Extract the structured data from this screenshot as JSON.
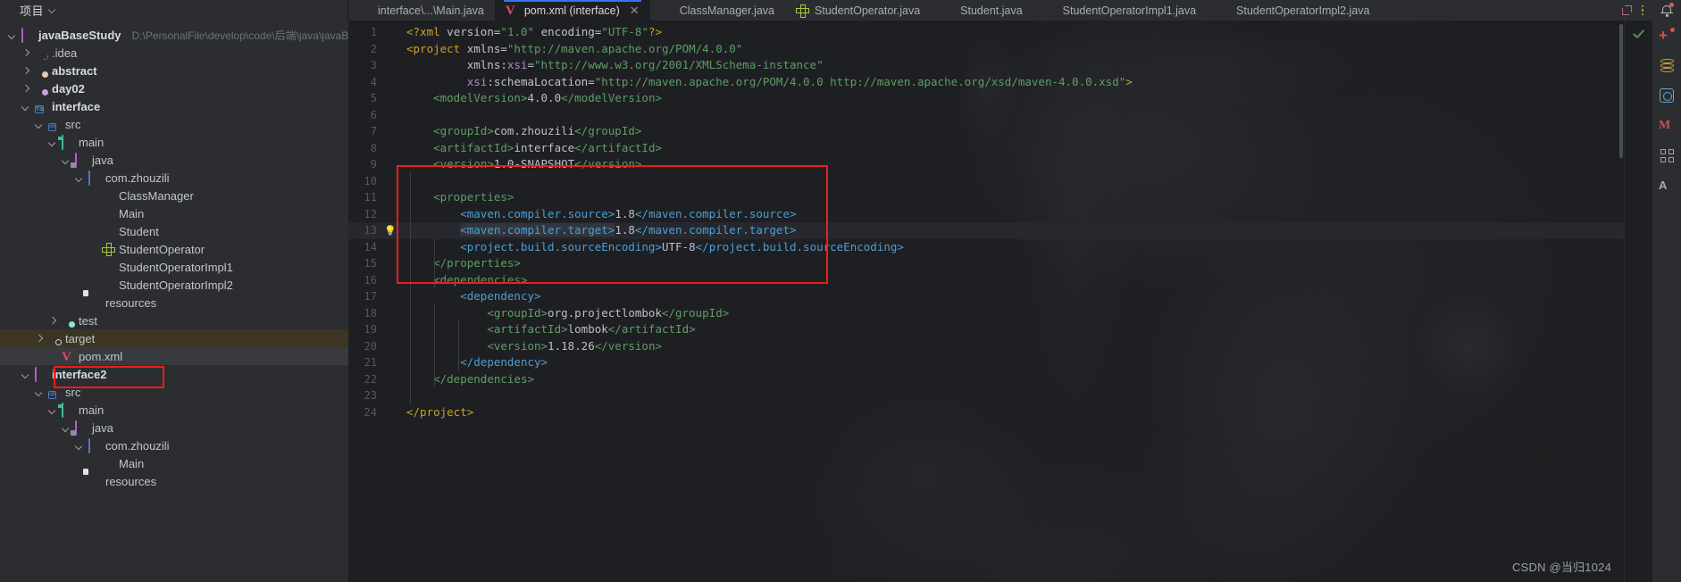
{
  "project_pane": {
    "title": "项目",
    "tree": [
      {
        "id": "javaBaseStudy",
        "label": "javaBaseStudy",
        "path": "D:\\PersonalFile\\develop\\code\\后端\\java\\javaBaseStud",
        "depth": 0,
        "arrow": "down",
        "icon": "folder-outline-purple",
        "bold": true
      },
      {
        "id": "idea",
        "label": ".idea",
        "depth": 1,
        "arrow": "right",
        "icon": "folder-idea",
        "bold": false
      },
      {
        "id": "abstract",
        "label": "abstract",
        "depth": 1,
        "arrow": "right",
        "icon": "folder-module-tan",
        "bold": true
      },
      {
        "id": "day02",
        "label": "day02",
        "depth": 1,
        "arrow": "right",
        "icon": "folder-module-purple",
        "bold": true
      },
      {
        "id": "interface",
        "label": "interface",
        "depth": 1,
        "arrow": "down",
        "icon": "folder-maven-module",
        "bold": true
      },
      {
        "id": "src",
        "label": "src",
        "depth": 2,
        "arrow": "down",
        "icon": "folder-src",
        "bold": false
      },
      {
        "id": "main",
        "label": "main",
        "depth": 3,
        "arrow": "down",
        "icon": "folder-main",
        "bold": false
      },
      {
        "id": "java",
        "label": "java",
        "depth": 4,
        "arrow": "down",
        "icon": "folder-java-source",
        "bold": false
      },
      {
        "id": "com.zhouzili",
        "label": "com.zhouzili",
        "depth": 5,
        "arrow": "down",
        "icon": "folder-package",
        "bold": false
      },
      {
        "id": "ClassManager",
        "label": "ClassManager",
        "depth": 6,
        "arrow": "none",
        "icon": "java-class",
        "bold": false
      },
      {
        "id": "Main",
        "label": "Main",
        "depth": 6,
        "arrow": "none",
        "icon": "java-class-runnable",
        "bold": false
      },
      {
        "id": "Student",
        "label": "Student",
        "depth": 6,
        "arrow": "none",
        "icon": "java-class",
        "bold": false
      },
      {
        "id": "StudentOperator",
        "label": "StudentOperator",
        "depth": 6,
        "arrow": "none",
        "icon": "java-interface",
        "bold": false
      },
      {
        "id": "StudentOperatorImpl1",
        "label": "StudentOperatorImpl1",
        "depth": 6,
        "arrow": "none",
        "icon": "java-class",
        "bold": false
      },
      {
        "id": "StudentOperatorImpl2",
        "label": "StudentOperatorImpl2",
        "depth": 6,
        "arrow": "none",
        "icon": "java-class",
        "bold": false
      },
      {
        "id": "resources",
        "label": "resources",
        "depth": 5,
        "arrow": "none",
        "icon": "folder-resources",
        "bold": false
      },
      {
        "id": "test",
        "label": "test",
        "depth": 3,
        "arrow": "right",
        "icon": "folder-test",
        "bold": false
      },
      {
        "id": "target",
        "label": "target",
        "depth": 2,
        "arrow": "right",
        "icon": "folder-target",
        "bold": false,
        "row_highlight": "amber"
      },
      {
        "id": "pom.xml",
        "label": "pom.xml",
        "depth": 3,
        "arrow": "none",
        "icon": "maven-pom",
        "bold": false,
        "row_highlight": "grey",
        "annotated": true
      },
      {
        "id": "interface2",
        "label": "interface2",
        "depth": 1,
        "arrow": "down",
        "icon": "folder-outline-purple",
        "bold": true
      },
      {
        "id": "src2",
        "label": "src",
        "depth": 2,
        "arrow": "down",
        "icon": "folder-src",
        "bold": false
      },
      {
        "id": "main2",
        "label": "main",
        "depth": 3,
        "arrow": "down",
        "icon": "folder-main",
        "bold": false
      },
      {
        "id": "java2",
        "label": "java",
        "depth": 4,
        "arrow": "down",
        "icon": "folder-java-source",
        "bold": false
      },
      {
        "id": "com.zhouzili2",
        "label": "com.zhouzili",
        "depth": 5,
        "arrow": "down",
        "icon": "folder-package",
        "bold": false
      },
      {
        "id": "Main2",
        "label": "Main",
        "depth": 6,
        "arrow": "none",
        "icon": "java-class-runnable",
        "bold": false
      },
      {
        "id": "resources2",
        "label": "resources",
        "depth": 5,
        "arrow": "none",
        "icon": "folder-resources",
        "bold": false
      }
    ]
  },
  "editor_tabs": [
    {
      "label": "interface\\...\\Main.java",
      "icon": "java-class",
      "active": false,
      "closable": false
    },
    {
      "label": "pom.xml (interface)",
      "icon": "maven-pom",
      "active": true,
      "closable": true,
      "close_glyph": "✕"
    },
    {
      "label": "ClassManager.java",
      "icon": "java-class",
      "active": false,
      "closable": false
    },
    {
      "label": "StudentOperator.java",
      "icon": "java-interface",
      "active": false,
      "closable": false
    },
    {
      "label": "Student.java",
      "icon": "java-class",
      "active": false,
      "closable": false
    },
    {
      "label": "StudentOperatorImpl1.java",
      "icon": "java-class",
      "active": false,
      "closable": false
    },
    {
      "label": "StudentOperatorImpl2.java",
      "icon": "java-class",
      "active": false,
      "closable": false
    }
  ],
  "tab_tools": {
    "expand": "expand-icon",
    "more": "more-options-icon"
  },
  "notification": {
    "icon": "bell-icon",
    "has_badge": true
  },
  "code": {
    "language": "xml",
    "lines": [
      {
        "n": 1,
        "indent": 0,
        "html": "<span class='ty'>&lt;?xml</span> <span class='at'>version=</span><span class='av'>\"1.0\"</span> <span class='at'>encoding=</span><span class='av'>\"UTF-8\"</span><span class='ty'>?&gt;</span>"
      },
      {
        "n": 2,
        "indent": 0,
        "html": "<span class='ty'>&lt;project</span> <span class='at'>xmlns=</span><span class='av'>\"http://maven.apache.org/POM/4.0.0\"</span>"
      },
      {
        "n": 3,
        "indent": 0,
        "html": "         <span class='at'>xmlns:</span><span class='vm'>xsi</span><span class='at'>=</span><span class='av'>\"http://www.w3.org/2001/XMLSchema-instance\"</span>"
      },
      {
        "n": 4,
        "indent": 0,
        "html": "         <span class='vm'>xsi</span><span class='at'>:schemaLocation=</span><span class='av'>\"http://maven.apache.org/POM/4.0.0 http://maven.apache.org/xsd/maven-4.0.0.xsd\"</span><span class='ty'>&gt;</span>"
      },
      {
        "n": 5,
        "indent": 0,
        "html": "    <span class='tg'>&lt;modelVersion&gt;</span><span class='tx'>4.0.0</span><span class='tg'>&lt;/modelVersion&gt;</span>"
      },
      {
        "n": 6,
        "indent": 0,
        "html": ""
      },
      {
        "n": 7,
        "indent": 0,
        "html": "    <span class='tg'>&lt;groupId&gt;</span><span class='tx'>com.zhouzili</span><span class='tg'>&lt;/groupId&gt;</span>"
      },
      {
        "n": 8,
        "indent": 0,
        "html": "    <span class='tg'>&lt;artifactId&gt;</span><span class='tx'>interface</span><span class='tg'>&lt;/artifactId&gt;</span>"
      },
      {
        "n": 9,
        "indent": 0,
        "html": "    <span class='tg'>&lt;version&gt;</span><span class='tx'>1.0-SNAPSHOT</span><span class='tg'>&lt;/version&gt;</span>"
      },
      {
        "n": 10,
        "indent": 0,
        "html": ""
      },
      {
        "n": 11,
        "indent": 0,
        "html": "    <span class='tg'>&lt;properties&gt;</span>"
      },
      {
        "n": 12,
        "indent": 0,
        "html": "        <span class='tgb'>&lt;maven.compiler.source&gt;</span><span class='tx'>1.8</span><span class='tgb'>&lt;/maven.compiler.source&gt;</span>"
      },
      {
        "n": 13,
        "indent": 0,
        "bulb": true,
        "highlight": true,
        "html": "        <span class='tgb sel-token'>&lt;maven.compiler.target&gt;</span><span class='tx'>1.8</span><span class='tgb'>&lt;/maven.compiler.target&gt;</span>"
      },
      {
        "n": 14,
        "indent": 0,
        "html": "        <span class='tgb'>&lt;project.build.sourceEncoding&gt;</span><span class='tx'>UTF-8</span><span class='tgb'>&lt;/project.build.sourceEncoding&gt;</span>"
      },
      {
        "n": 15,
        "indent": 0,
        "html": "    <span class='tg'>&lt;/properties&gt;</span>"
      },
      {
        "n": 16,
        "indent": 0,
        "html": "    <span class='tg'>&lt;dependencies&gt;</span>"
      },
      {
        "n": 17,
        "indent": 0,
        "html": "        <span class='tgb'>&lt;dependency&gt;</span>"
      },
      {
        "n": 18,
        "indent": 0,
        "html": "            <span class='tg'>&lt;groupId&gt;</span><span class='tx'>org.projectlombok</span><span class='tg'>&lt;/groupId&gt;</span>"
      },
      {
        "n": 19,
        "indent": 0,
        "html": "            <span class='tg'>&lt;artifactId&gt;</span><span class='tx'>lombok</span><span class='tg'>&lt;/artifactId&gt;</span>"
      },
      {
        "n": 20,
        "indent": 0,
        "html": "            <span class='tg'>&lt;version&gt;</span><span class='tx'>1.18.26</span><span class='tg'>&lt;/version&gt;</span>"
      },
      {
        "n": 21,
        "indent": 0,
        "html": "        <span class='tgb'>&lt;/dependency&gt;</span>"
      },
      {
        "n": 22,
        "indent": 0,
        "html": "    <span class='tg'>&lt;/dependencies&gt;</span>"
      },
      {
        "n": 23,
        "indent": 0,
        "html": ""
      },
      {
        "n": 24,
        "indent": 0,
        "html": "<span class='ty'>&lt;/project&gt;</span>"
      }
    ]
  },
  "annotations": {
    "code_box": {
      "label": "properties-highlight-box",
      "color": "#ef1d1d"
    },
    "tree_box": {
      "label": "pom-xml-highlight-box",
      "color": "#ef1d1d"
    }
  },
  "right_rail_icons": [
    "notifications-icon",
    "add-icon",
    "database-icon",
    "bean-validation-icon",
    "maven-icon",
    "structure-icon",
    "ai-assistant-icon"
  ],
  "editor_rail_icons": [
    "inspection-ok-icon"
  ],
  "watermark": "CSDN @当归1024"
}
